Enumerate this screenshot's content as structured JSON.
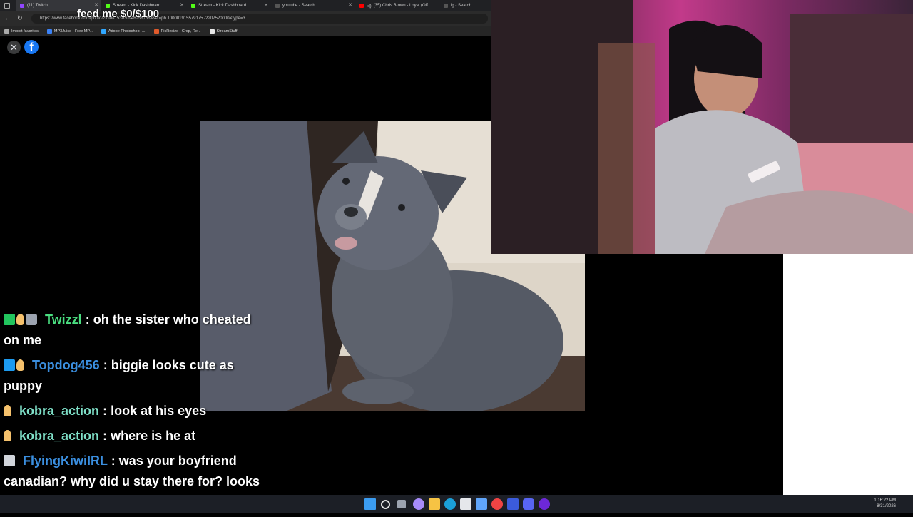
{
  "browser": {
    "tabs": [
      {
        "label": "(11) Twitch",
        "color": "#9146ff"
      },
      {
        "label": "Stream - Kick Dashboard",
        "color": "#53fc18"
      },
      {
        "label": "Stream - Kick Dashboard",
        "color": "#53fc18"
      },
      {
        "label": "youtube - Search",
        "color": "#555"
      },
      {
        "label": "(35) Chris Brown - Loyal (Off...",
        "color": "#ff0000"
      },
      {
        "label": "ig - Search",
        "color": "#555"
      }
    ],
    "url": "https://www.facebook.com/photo/?fbid=153830946238788&set=pb.100001915579175.-2207520000&type=3",
    "bookmarks": [
      {
        "label": "Import favorites",
        "color": "#aaa"
      },
      {
        "label": "MP3Juice - Free MP...",
        "color": "#3b82f6"
      },
      {
        "label": "Adobe Photoshop -...",
        "color": "#31a8ff"
      },
      {
        "label": "PicResize - Crop, Re...",
        "color": "#e05a2b"
      },
      {
        "label": "StreamStuff",
        "color": "#e8e8e8"
      }
    ]
  },
  "overlay": {
    "feed_text": "feed me $0/$100"
  },
  "viewer": {
    "close_glyph": "✕",
    "logo_glyph": "f"
  },
  "chat": [
    {
      "user": "Twizzl",
      "user_color": "#4ade80",
      "text": ": oh the sister who cheated on me",
      "badges": [
        "check-badge",
        "hand-badge",
        "camera-badge"
      ]
    },
    {
      "user": "Topdog456",
      "user_color": "#3b8fe0",
      "text": ": biggie looks cute as puppy",
      "badges": [
        "hammer-badge",
        "hand-badge"
      ]
    },
    {
      "user": "kobra_action",
      "user_color": "#7fe0c8",
      "text": ": look at his eyes",
      "badges": [
        "hand-badge"
      ]
    },
    {
      "user": "kobra_action",
      "user_color": "#7fe0c8",
      "text": ": where is he at",
      "badges": [
        "hand-badge"
      ]
    },
    {
      "user": "FlyingKiwiIRL",
      "user_color": "#3b8fe0",
      "text": ": was your boyfriend canadian? why did u stay there for? looks so cold",
      "badges": [
        "money-badge"
      ]
    }
  ],
  "taskbar": {
    "icons": [
      "windows-icon",
      "search-icon",
      "task-view-icon",
      "copilot-icon",
      "file-explorer-icon",
      "edge-icon",
      "store-icon",
      "photos-icon",
      "chrome-icon",
      "notion-icon",
      "discord-icon",
      "obs-icon"
    ],
    "time": "1:16:22 PM",
    "date": "8/31/2026"
  }
}
